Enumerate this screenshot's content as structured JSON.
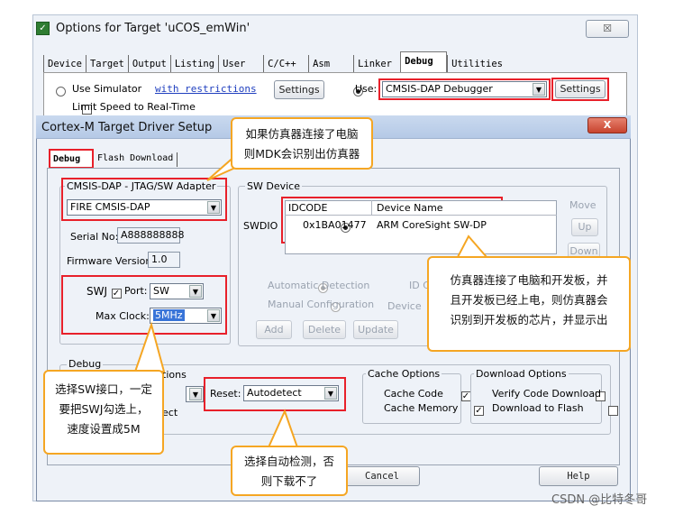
{
  "outer": {
    "title": "Options for Target 'uCOS_emWin'",
    "close_label": "☒",
    "tabs": [
      "Device",
      "Target",
      "Output",
      "Listing",
      "User",
      "C/C++",
      "Asm",
      "Linker",
      "Debug",
      "Utilities"
    ],
    "active_tab": "Debug",
    "use_simulator_label": "Use Simulator",
    "restrictions_link": "with restrictions",
    "settings_label": "Settings",
    "use_label": "Use:",
    "debugger_value": "CMSIS-DAP Debugger",
    "settings2_label": "Settings",
    "limit_speed_label": "Limit Speed to Real-Time"
  },
  "inner": {
    "title": "Cortex-M Target Driver Setup",
    "close_label": "X",
    "tabs": [
      "Debug",
      "Flash Download"
    ],
    "adapter_group": "CMSIS-DAP - JTAG/SW Adapter",
    "adapter_value": "FIRE CMSIS-DAP",
    "serial_label": "Serial No:",
    "serial_value": "A888888888",
    "firmware_label": "Firmware Version:",
    "firmware_value": "1.0",
    "swj_label": "SWJ",
    "port_label": "Port:",
    "port_value": "SW",
    "maxclock_label": "Max Clock:",
    "maxclock_value": "5MHz",
    "swdevice_group": "SW Device",
    "swdio_label": "SWDIO",
    "col_idcode": "IDCODE",
    "col_devname": "Device Name",
    "row_idcode": "0x1BA01477",
    "row_devname": "ARM CoreSight SW-DP",
    "move_label": "Move",
    "up_label": "Up",
    "down_label": "Down",
    "auto_detect_label": "Automatic Detection",
    "manual_config_label": "Manual Configuration",
    "id_label": "ID C",
    "device_label": "Device",
    "add_label": "Add",
    "delete_label": "Delete",
    "update_label": "Update",
    "debug_group": "Debug",
    "options_partial": "tions",
    "ect_partial": "ect",
    "reset_label": "Reset:",
    "reset_value": "Autodetect",
    "cache_group": "Cache Options",
    "cache_code": "Cache Code",
    "cache_memory": "Cache Memory",
    "download_group": "Download Options",
    "verify_label": "Verify Code Download",
    "download_flash_label": "Download to Flash",
    "cancel_label": "Cancel",
    "help_label": "Help"
  },
  "callouts": {
    "c1_line1": "如果仿真器连接了电脑",
    "c1_line2": "则MDK会识别出仿真器",
    "c2_line1": "仿真器连接了电脑和开发板，并",
    "c2_line2": "且开发板已经上电，则仿真器会",
    "c2_line3": "识别到开发板的芯片，并显示出",
    "c3_line1": "选择SW接口，一定",
    "c3_line2": "要把SWJ勾选上，",
    "c3_line3": "速度设置成5M",
    "c4_line1": "选择自动检测，否",
    "c4_line2": "则下载不了"
  },
  "watermark": "CSDN @比特冬哥"
}
